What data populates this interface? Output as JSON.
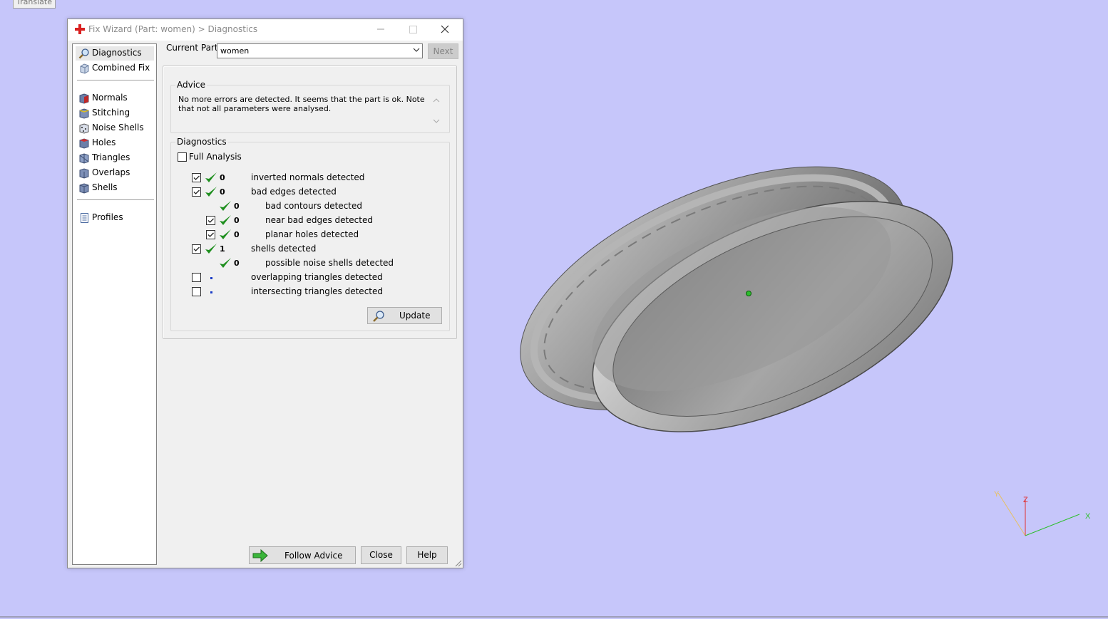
{
  "window": {
    "title": "Fix Wizard (Part: women) > Diagnostics"
  },
  "top_tab": {
    "label": "Translate"
  },
  "sidebar": {
    "items": [
      {
        "label": "Diagnostics",
        "icon": "magnifier-icon",
        "selected": true
      },
      {
        "label": "Combined Fix",
        "icon": "combined-fix-icon"
      },
      {
        "label": "Normals",
        "icon": "normals-icon"
      },
      {
        "label": "Stitching",
        "icon": "stitching-icon"
      },
      {
        "label": "Noise Shells",
        "icon": "noise-shells-icon"
      },
      {
        "label": "Holes",
        "icon": "holes-icon"
      },
      {
        "label": "Triangles",
        "icon": "triangles-icon"
      },
      {
        "label": "Overlaps",
        "icon": "overlaps-icon"
      },
      {
        "label": "Shells",
        "icon": "shells-icon"
      },
      {
        "label": "Profiles",
        "icon": "profiles-icon"
      }
    ]
  },
  "header": {
    "current_part_label": "Current Part:",
    "current_part_value": "women",
    "next_label": "Next"
  },
  "advice": {
    "legend": "Advice",
    "text": "No more errors are detected. It seems that the part is ok. Note that not all parameters were analysed."
  },
  "diagnostics": {
    "legend": "Diagnostics",
    "full_analysis_label": "Full Analysis",
    "rows": [
      {
        "checked": true,
        "has_checkbox": true,
        "status": "ok",
        "count": "0",
        "label": "inverted normals detected",
        "indent": 0
      },
      {
        "checked": true,
        "has_checkbox": true,
        "status": "ok",
        "count": "0",
        "label": "bad edges detected",
        "indent": 0
      },
      {
        "checked": false,
        "has_checkbox": false,
        "status": "ok",
        "count": "0",
        "label": "bad contours detected",
        "indent": 1
      },
      {
        "checked": true,
        "has_checkbox": true,
        "status": "ok",
        "count": "0",
        "label": "near bad edges detected",
        "indent": 1
      },
      {
        "checked": true,
        "has_checkbox": true,
        "status": "ok",
        "count": "0",
        "label": "planar holes detected",
        "indent": 1
      },
      {
        "checked": true,
        "has_checkbox": true,
        "status": "ok",
        "count": "1",
        "label": "shells detected",
        "indent": 0
      },
      {
        "checked": false,
        "has_checkbox": false,
        "status": "ok",
        "count": "0",
        "label": "possible noise shells detected",
        "indent": 1
      },
      {
        "checked": false,
        "has_checkbox": true,
        "status": "not-analysed",
        "count": "",
        "label": "overlapping triangles detected",
        "indent": 0
      },
      {
        "checked": false,
        "has_checkbox": true,
        "status": "not-analysed",
        "count": "",
        "label": "intersecting triangles detected",
        "indent": 0
      }
    ],
    "update_label": "Update"
  },
  "footer": {
    "follow_advice_label": "Follow Advice",
    "close_label": "Close",
    "help_label": "Help"
  },
  "axes": {
    "x": "X",
    "y": "Y",
    "z": "Z"
  },
  "colors": {
    "background": "#c6c6fa",
    "check_green": "#1f8f1f",
    "dot_blue": "#1a3cc6",
    "title_icon_red": "#d92020"
  }
}
